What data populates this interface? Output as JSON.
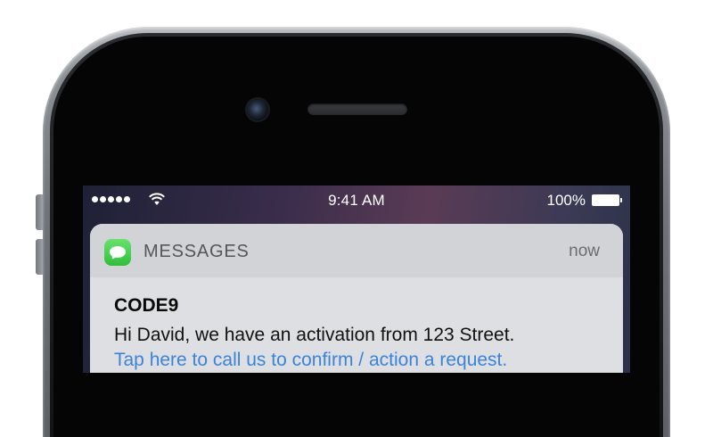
{
  "status_bar": {
    "signal_dots": 5,
    "wifi_icon": "wifi-icon",
    "time": "9:41 AM",
    "battery_percent": "100%",
    "battery_level": 1.0
  },
  "notification": {
    "app_icon": "messages-app-icon",
    "app_name": "MESSAGES",
    "time": "now",
    "sender": "CODE9",
    "message": "Hi David, we have an activation from 123 Street.",
    "link_text": "Tap here to call us to confirm / action a request."
  },
  "colors": {
    "app_icon_green": "#3ccf45",
    "link_blue": "#3a84d8"
  }
}
